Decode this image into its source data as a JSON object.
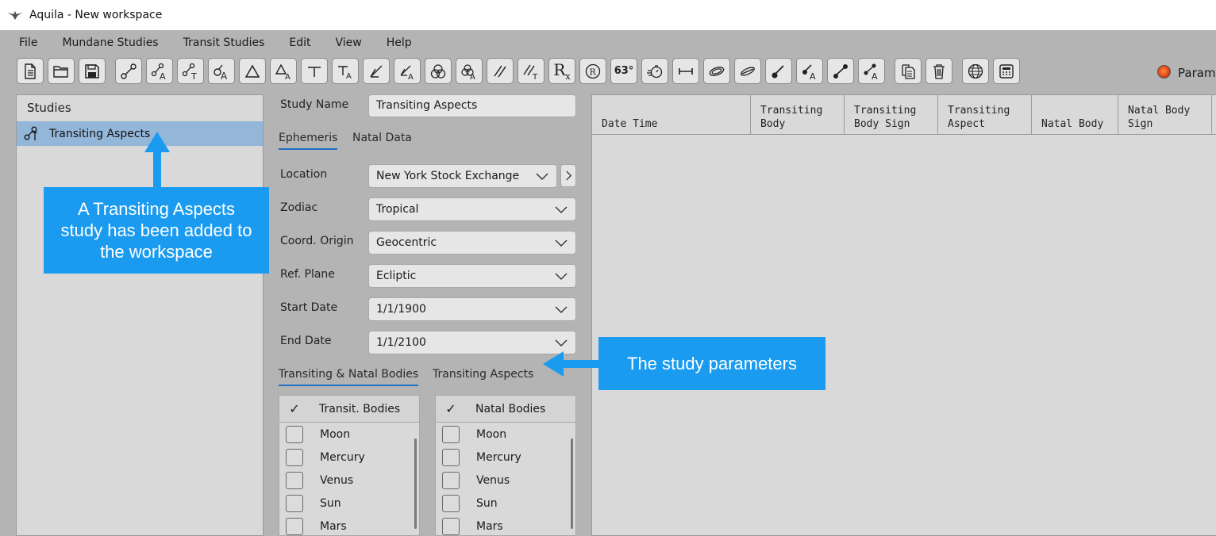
{
  "window": {
    "title": "Aquila - New workspace"
  },
  "menu": [
    "File",
    "Mundane Studies",
    "Transit Studies",
    "Edit",
    "View",
    "Help"
  ],
  "toolbar": {
    "angle_button_label": "63°",
    "rx_label": "R",
    "rx_sub": "x",
    "parameters_label": "Parame"
  },
  "studies": {
    "header": "Studies",
    "items": [
      {
        "label": "Transiting Aspects",
        "selected": true
      }
    ]
  },
  "study": {
    "name_label": "Study Name",
    "name_value": "Transiting Aspects",
    "tabs": [
      "Ephemeris",
      "Natal Data"
    ],
    "fields": {
      "location": {
        "label": "Location",
        "value": "New York Stock Exchange"
      },
      "zodiac": {
        "label": "Zodiac",
        "value": "Tropical"
      },
      "coord_origin": {
        "label": "Coord. Origin",
        "value": "Geocentric"
      },
      "ref_plane": {
        "label": "Ref. Plane",
        "value": "Ecliptic"
      },
      "start_date": {
        "label": "Start Date",
        "value": "1/1/1900"
      },
      "end_date": {
        "label": "End Date",
        "value": "1/1/2100"
      }
    },
    "body_tabs": [
      "Transiting & Natal Bodies",
      "Transiting Aspects"
    ],
    "check_glyph": "✓",
    "transit_list": {
      "header": "Transit. Bodies",
      "items": [
        "Moon",
        "Mercury",
        "Venus",
        "Sun",
        "Mars"
      ]
    },
    "natal_list": {
      "header": "Natal Bodies",
      "items": [
        "Moon",
        "Mercury",
        "Venus",
        "Sun",
        "Mars"
      ]
    }
  },
  "results": {
    "columns": [
      "Date Time",
      "Transiting\nBody",
      "Transiting\nBody Sign",
      "Transiting\nAspect",
      "Natal Body",
      "Natal Body\nSign"
    ]
  },
  "callouts": {
    "studies": "A Transiting Aspects study has been added to the workspace",
    "parameters": "The study parameters"
  },
  "colors": {
    "callout": "#1a9bf0",
    "selection": "#94b6d9",
    "tab_underline": "#1f6fc6",
    "led": "#e2491a"
  }
}
